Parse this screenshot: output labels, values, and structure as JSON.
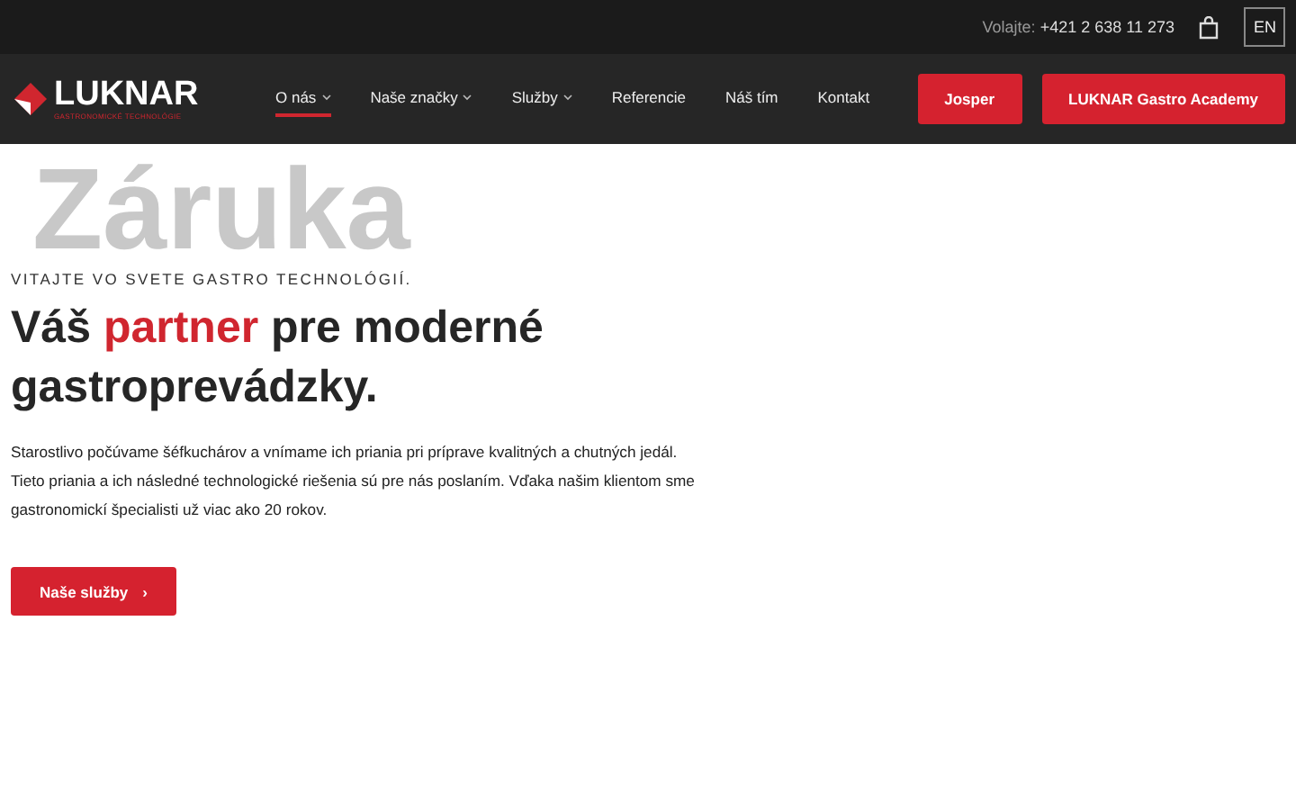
{
  "top_bar": {
    "phone_label": "Volajte:",
    "phone": "+421 2 638 11 273",
    "language": "EN"
  },
  "header": {
    "logo": {
      "name": "LUKNAR",
      "tagline": "GASTRONOMICKÉ TECHNOLÓGIE"
    },
    "nav": [
      {
        "label": "O nás",
        "dropdown": true,
        "selected": true
      },
      {
        "label": "Naše značky",
        "dropdown": true,
        "selected": false
      },
      {
        "label": "Služby",
        "dropdown": true,
        "selected": false
      },
      {
        "label": "Referencie",
        "dropdown": false,
        "selected": false
      },
      {
        "label": "Náš tím",
        "dropdown": false,
        "selected": false
      },
      {
        "label": "Kontakt",
        "dropdown": false,
        "selected": false
      }
    ],
    "buttons": [
      "Josper",
      "LUKNAR Gastro Academy"
    ]
  },
  "hero": {
    "watermark": "Záruka",
    "eyebrow": "VITAJTE VO SVETE GASTRO TECHNOLÓGIÍ.",
    "heading": "Váš **partner** pre moderné gastroprevádzky.",
    "text": "Starostlivo počúvame šéfkuchárov a vnímame ich priania pri príprave kvalitných a chutných jedál. Tieto priania a ich následné technologické riešenia sú pre nás poslaním. Vďaka našim klientom sme gastronomickí špecialisti už viac ako 20 rokov.",
    "button": "Naše služby",
    "button_arrow": "›"
  }
}
